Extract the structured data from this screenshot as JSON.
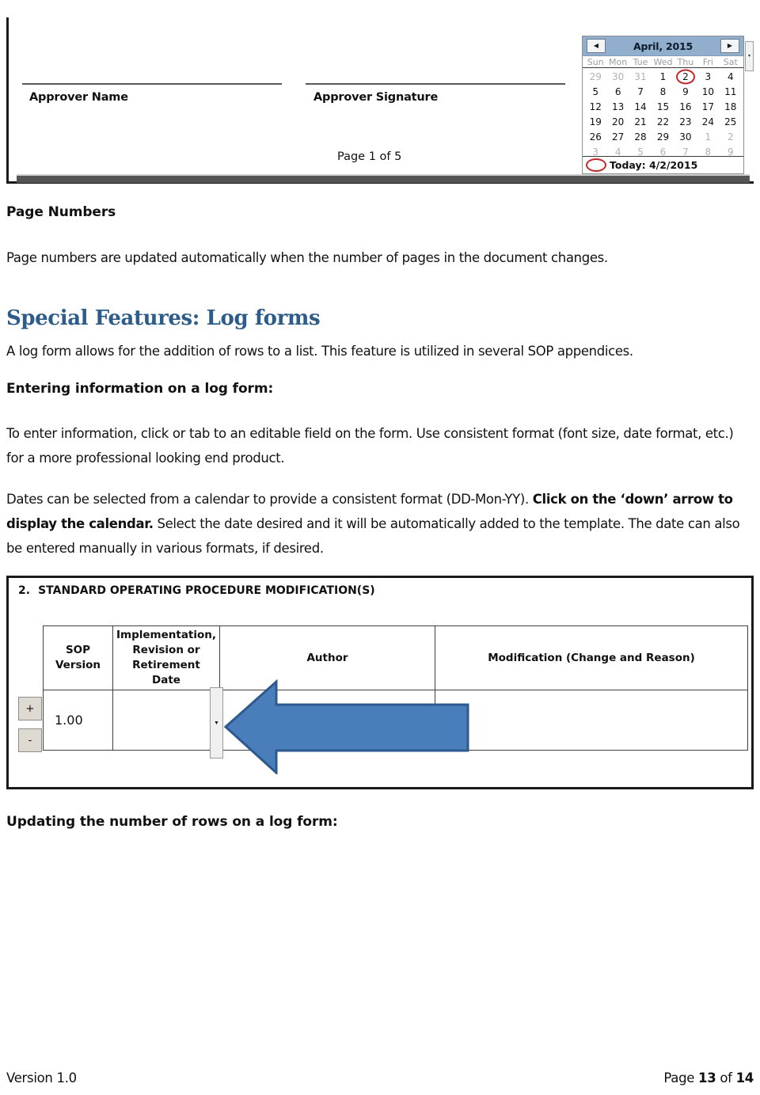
{
  "document": {
    "footer": {
      "version_label": "Version 1.0",
      "page_prefix": "Page ",
      "page_current": "13",
      "page_middle": " of ",
      "page_total": "14"
    }
  },
  "figure_approver": {
    "approver_name_label": "Approver Name",
    "approver_signature_label": "Approver Signature",
    "page_of_label": "Page 1 of 5",
    "calendar": {
      "prev_icon": "◀",
      "next_icon": "▶",
      "dropdown_icon": "▾",
      "title": "April, 2015",
      "weekdays": [
        "Sun",
        "Mon",
        "Tue",
        "Wed",
        "Thu",
        "Fri",
        "Sat"
      ],
      "weeks": [
        [
          {
            "d": "29",
            "dim": true
          },
          {
            "d": "30",
            "dim": true
          },
          {
            "d": "31",
            "dim": true
          },
          {
            "d": "1"
          },
          {
            "d": "2",
            "today": true
          },
          {
            "d": "3"
          },
          {
            "d": "4"
          }
        ],
        [
          {
            "d": "5"
          },
          {
            "d": "6"
          },
          {
            "d": "7"
          },
          {
            "d": "8"
          },
          {
            "d": "9"
          },
          {
            "d": "10"
          },
          {
            "d": "11"
          }
        ],
        [
          {
            "d": "12"
          },
          {
            "d": "13"
          },
          {
            "d": "14"
          },
          {
            "d": "15"
          },
          {
            "d": "16"
          },
          {
            "d": "17"
          },
          {
            "d": "18"
          }
        ],
        [
          {
            "d": "19"
          },
          {
            "d": "20"
          },
          {
            "d": "21"
          },
          {
            "d": "22"
          },
          {
            "d": "23"
          },
          {
            "d": "24"
          },
          {
            "d": "25"
          }
        ],
        [
          {
            "d": "26"
          },
          {
            "d": "27"
          },
          {
            "d": "28"
          },
          {
            "d": "29"
          },
          {
            "d": "30"
          },
          {
            "d": "1",
            "dim": true
          },
          {
            "d": "2",
            "dim": true
          }
        ],
        [
          {
            "d": "3",
            "dim": true
          },
          {
            "d": "4",
            "dim": true
          },
          {
            "d": "5",
            "dim": true
          },
          {
            "d": "6",
            "dim": true
          },
          {
            "d": "7",
            "dim": true
          },
          {
            "d": "8",
            "dim": true
          },
          {
            "d": "9",
            "dim": true
          }
        ]
      ],
      "today_text": "Today: 4/2/2015",
      "selected_day": "2",
      "header_color": "#91aecd",
      "highlight_color": "#c02a2a"
    }
  },
  "sections": {
    "page_numbers": {
      "heading": "Page Numbers",
      "body": "Page numbers are updated automatically when the number of pages in the document changes."
    },
    "special_features": {
      "heading": "Special Features: Log forms",
      "heading_color": "#2e5c8a",
      "body": "A log form allows for the addition of rows to a list. This feature is utilized in several SOP appendices."
    },
    "entering_information": {
      "heading": "Entering information on a log form:",
      "body": "To enter information, click or tab to an editable field on the form.  Use consistent format (font size, date format, etc.) for a more professional looking end product."
    },
    "dates_paragraph": {
      "part1": "Dates can be selected from a calendar to provide a consistent format (DD-Mon-YY). ",
      "bold": "Click on the ‘down’ arrow to display the calendar.",
      "part2": " Select the date desired and it will be automatically added to the template. The date can also be entered manually in various formats, if desired."
    },
    "updating_rows": {
      "heading": "Updating the number of rows on a log form:"
    }
  },
  "figure_table": {
    "caption_number": "2.",
    "caption_text": "STANDARD OPERATING PROCEDURE MODIFICATION(S)",
    "columns": [
      "SOP Version",
      "Implementation, Revision or Retirement Date",
      "Author",
      "Modification (Change and Reason)"
    ],
    "rows": [
      {
        "sop_version": "1.00",
        "date": "",
        "author": "",
        "modification": ""
      }
    ],
    "add_row_label": "+",
    "remove_row_label": "-",
    "dropdown_icon": "▼",
    "callout_arrow": {
      "direction": "left",
      "fill_color": "#4a7ebb",
      "stroke_color": "#2d5a8e"
    }
  }
}
